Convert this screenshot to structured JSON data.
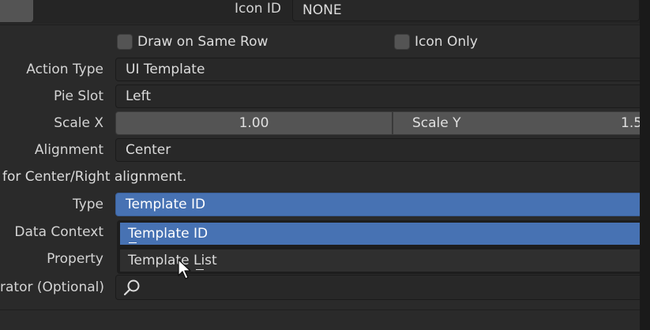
{
  "header": {
    "icon_id_label": "Icon ID",
    "icon_id_value": "NONE"
  },
  "options": {
    "draw_same_row": "Draw on Same Row",
    "icon_only": "Icon Only"
  },
  "rows": {
    "action_type": {
      "label": "Action Type",
      "value": "UI Template"
    },
    "pie_slot": {
      "label": "Pie Slot",
      "value": "Left"
    },
    "scale": {
      "label_x": "Scale X",
      "value_x": "1.00",
      "label_y": "Scale Y",
      "value_y": "1.5"
    },
    "alignment": {
      "label": "Alignment",
      "value": "Center"
    },
    "note": "for Center/Right alignment.",
    "type": {
      "label": "Type",
      "value": "Template ID"
    },
    "data_context": {
      "label": "Data Context"
    },
    "property": {
      "label": "Property"
    },
    "operator": {
      "label": "rator (Optional)"
    }
  },
  "menu": {
    "items": [
      "Template ID",
      "Template List"
    ]
  },
  "icons": {
    "search": "search-icon",
    "cursor": "mouse-pointer-icon"
  },
  "colors": {
    "accent": "#4772b3",
    "background": "#2a2a2a",
    "field": "#282828",
    "numfield": "#545454"
  }
}
